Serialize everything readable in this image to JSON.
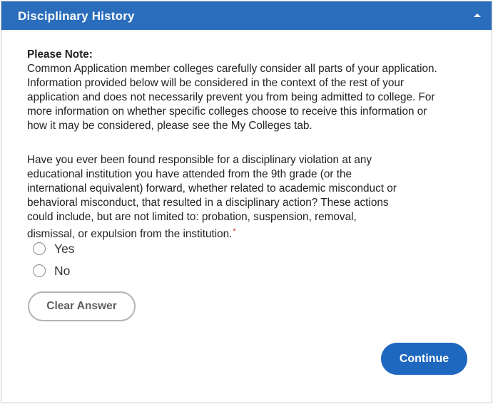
{
  "header": {
    "title": "Disciplinary History",
    "collapse_icon": "chevron-up-icon"
  },
  "note": {
    "title": "Please Note:",
    "lines": [
      "Common Application member colleges carefully consider all parts of your application.",
      "Information provided below will be considered in the context of the rest of your",
      "application and does not necessarily prevent you from being admitted to college. For",
      "more information on whether specific colleges choose to receive this information or",
      "how it may be considered, please see the My Colleges tab."
    ]
  },
  "question": {
    "lines": [
      "Have you ever been found responsible for a disciplinary violation at any",
      "educational institution you have attended from the 9th grade (or the",
      "international equivalent) forward, whether related to academic misconduct or",
      "behavioral misconduct, that resulted in a disciplinary action? These actions",
      "could include, but are not limited to: probation, suspension, removal,",
      "dismissal, or expulsion from the institution."
    ],
    "required_marker": "*",
    "options": [
      {
        "label": "Yes",
        "selected": false
      },
      {
        "label": "No",
        "selected": false
      }
    ]
  },
  "buttons": {
    "clear": "Clear Answer",
    "continue": "Continue"
  },
  "colors": {
    "header_bg": "#2a6dbd",
    "primary_button": "#1f68c0",
    "required": "#d0312d"
  }
}
